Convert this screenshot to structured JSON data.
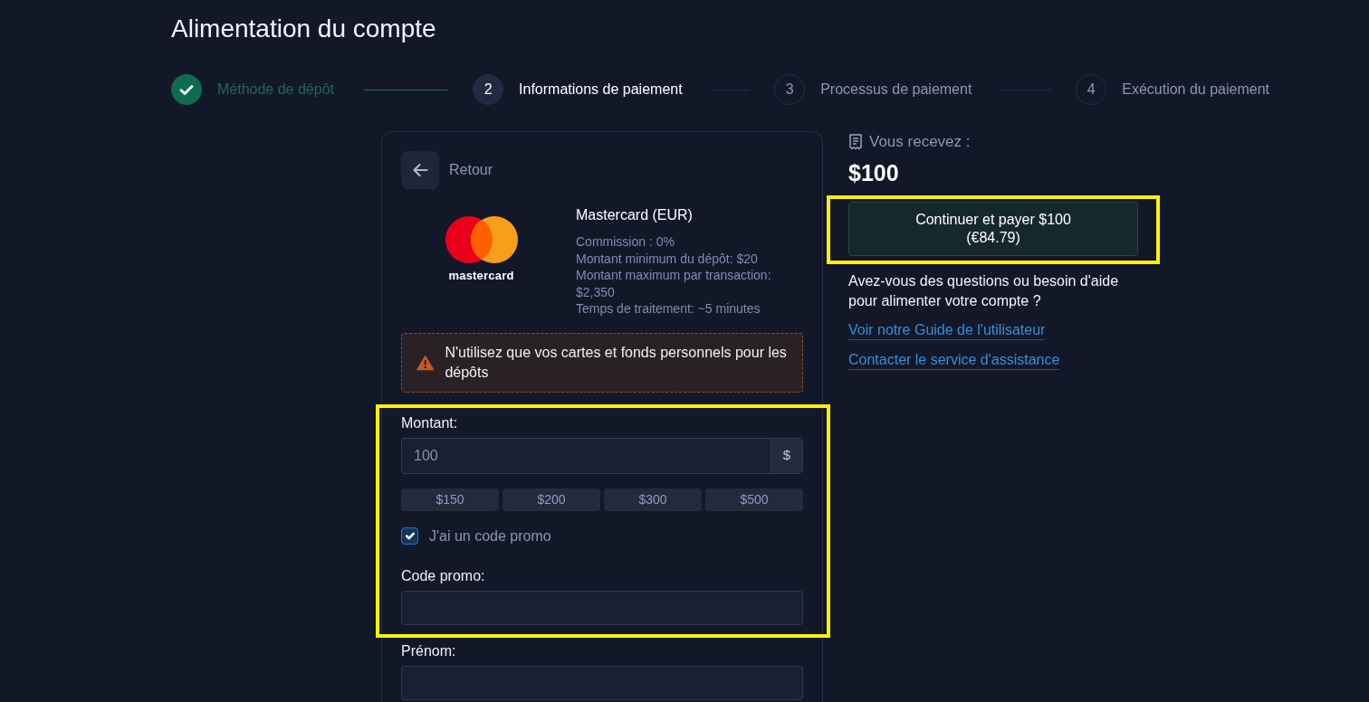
{
  "page_title": "Alimentation du compte",
  "steps": [
    {
      "label": "Méthode de dépôt",
      "completed": true,
      "current": false
    },
    {
      "number": "2",
      "label": "Informations de paiement",
      "completed": false,
      "current": true
    },
    {
      "number": "3",
      "label": "Processus de paiement",
      "completed": false,
      "current": false
    },
    {
      "number": "4",
      "label": "Exécution du paiement",
      "completed": false,
      "current": false
    }
  ],
  "payment_form": {
    "back_label": "Retour",
    "method": {
      "logo_text": "mastercard",
      "name": "Mastercard (EUR)",
      "details": [
        "Commission : 0%",
        "Montant minimum du dépôt: $20",
        "Montant maximum par transaction: $2,350",
        "Temps de traitement: ~5 minutes"
      ]
    },
    "warning": "N'utilisez que vos cartes et fonds personnels pour les dépôts",
    "amount_section": {
      "highlighted": true,
      "amount": {
        "label": "Montant:",
        "value": "100",
        "currency": "$"
      },
      "presets": [
        "$150",
        "$200",
        "$300",
        "$500"
      ],
      "promo_toggle": {
        "label": "J'ai un code promo",
        "checked": true
      },
      "promo_code": {
        "label": "Code promo:"
      }
    },
    "first_name": {
      "label": "Prénom:"
    }
  },
  "summary": {
    "label": "Vous recevez :",
    "amount": "$100",
    "pay_button": {
      "label": "Continuer et payer $100",
      "converted": "(€84.79)",
      "highlighted": true
    },
    "help_text": "Avez-vous des questions ou besoin d'aide pour alimenter votre compte ?",
    "links": [
      "Voir notre Guide de l'utilisateur",
      "Contacter le service d'assistance"
    ]
  }
}
